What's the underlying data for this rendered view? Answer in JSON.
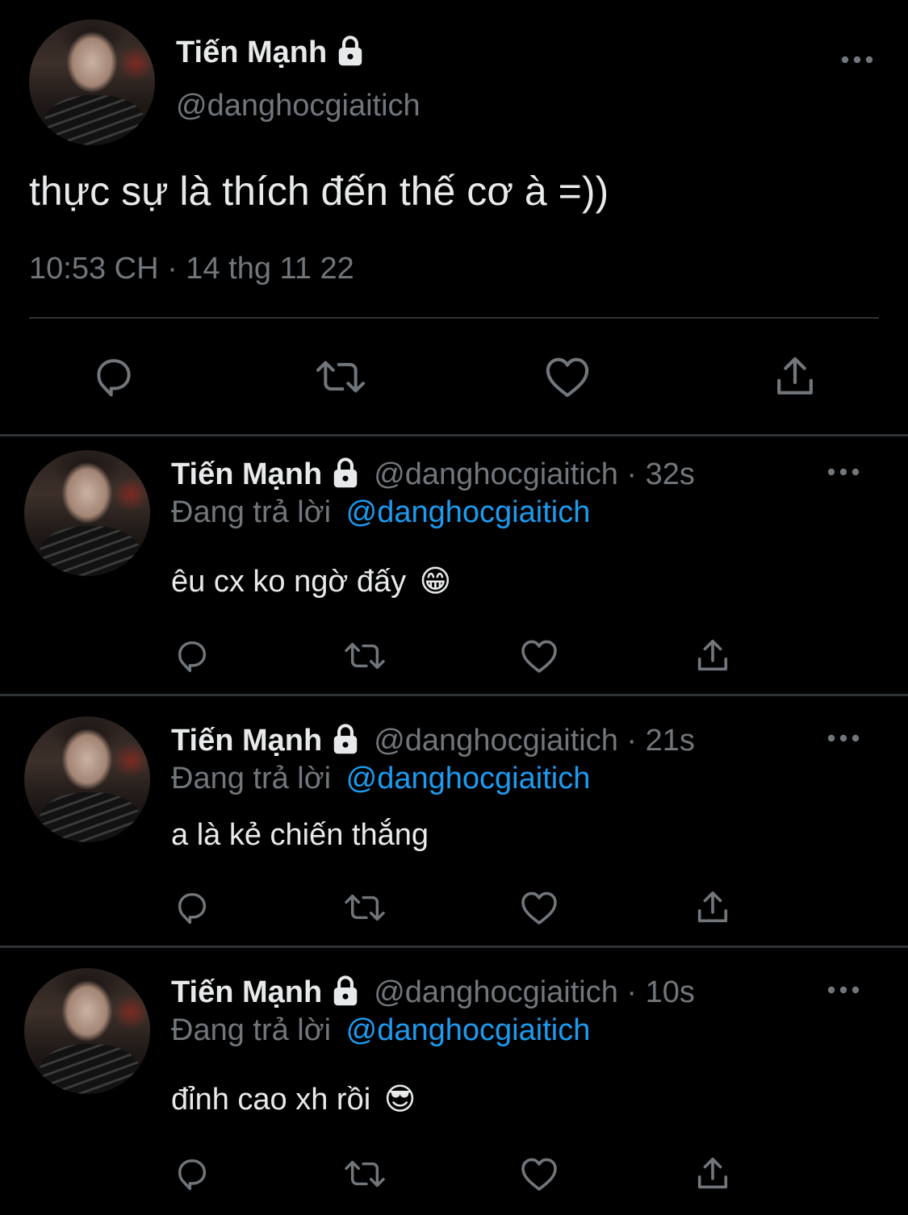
{
  "main_tweet": {
    "display_name": "Tiến Mạnh",
    "handle": "@danghocgiaitich",
    "text": "thực sự là thích đến thế cơ à =))",
    "timestamp": "10:53 CH · 14 thg 11 22",
    "icons": [
      "lock-icon",
      "more-icon",
      "reply-icon",
      "retweet-icon",
      "like-icon",
      "share-icon"
    ]
  },
  "replies": [
    {
      "display_name": "Tiến Mạnh",
      "handle_time": "@danghocgiaitich · 32s",
      "replying_prefix": "Đang trả lời",
      "replying_to": "@danghocgiaitich",
      "text": "êu cx ko ngờ đấy",
      "emoji": "😁"
    },
    {
      "display_name": "Tiến Mạnh",
      "handle_time": "@danghocgiaitich · 21s",
      "replying_prefix": "Đang trả lời",
      "replying_to": "@danghocgiaitich",
      "text": "a là kẻ chiến thắng",
      "emoji": ""
    },
    {
      "display_name": "Tiến Mạnh",
      "handle_time": "@danghocgiaitich · 10s",
      "replying_prefix": "Đang trả lời",
      "replying_to": "@danghocgiaitich",
      "text": "đỉnh cao xh rồi",
      "emoji": "😎"
    }
  ],
  "colors": {
    "background": "#000000",
    "text": "#e7e9ea",
    "muted": "#71767b",
    "link": "#1d9bf0",
    "divider": "#2f3336"
  }
}
